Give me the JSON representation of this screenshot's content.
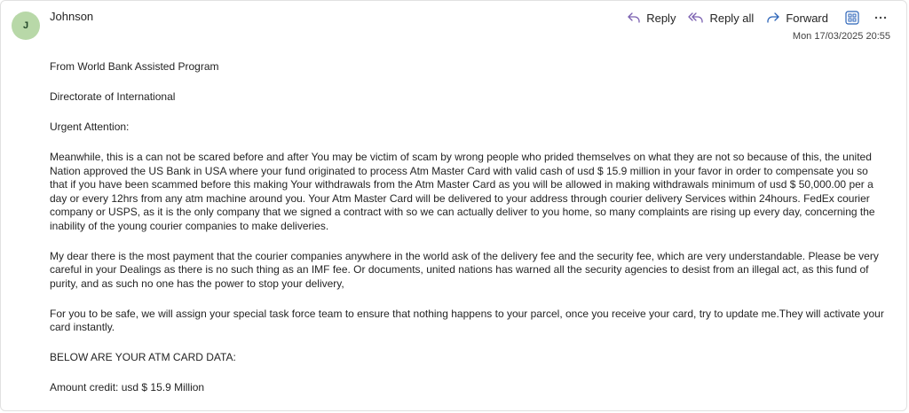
{
  "sender": {
    "avatar_initial": "J",
    "name": "Johnson"
  },
  "actions": {
    "reply": "Reply",
    "reply_all": "Reply all",
    "forward": "Forward"
  },
  "timestamp": "Mon 17/03/2025 20:55",
  "colors": {
    "accent": "#7a5fb0",
    "icon_blue": "#2b63b8",
    "avatar_bg": "#b8d8a8"
  },
  "body": {
    "p1": "From World Bank Assisted Program",
    "p2": "Directorate of International",
    "p3": "Urgent Attention:",
    "p4": "Meanwhile, this is a can not be scared before and after You may be victim of scam by wrong people who prided themselves on what they are not so because of this, the united Nation approved the US Bank in USA where your fund originated to process Atm Master Card with valid cash of usd $ 15.9 million in your favor in order to compensate you so that if you have been scammed before this making Your withdrawals from the Atm Master Card as you will be allowed in making withdrawals minimum of usd $ 50,000.00 per a day or every 12hrs from any atm machine around you. Your Atm Master Card will be delivered to your address through courier delivery Services within 24hours. FedEx courier company or USPS, as it is the only company that we signed a contract with so we can actually deliver to you home, so many complaints are rising up every day, concerning the inability of the young courier companies to make deliveries.",
    "p5": "My dear there is the most payment that the courier companies anywhere in the world ask of the delivery fee and the security fee, which are very understandable. Please be very careful in your Dealings as there is no such thing as an IMF fee. Or documents, united nations has warned all the security agencies to desist from an illegal act, as this fund of purity, and as such no one has the power to stop your delivery,",
    "p6": "For you to be safe, we will assign your special task force team to ensure that nothing happens to your parcel, once you receive your card, try to update me.They will activate your card instantly.",
    "p7": "BELOW ARE YOUR ATM CARD DATA:",
    "p8": "Amount credit: usd $ 15.9 Million"
  }
}
